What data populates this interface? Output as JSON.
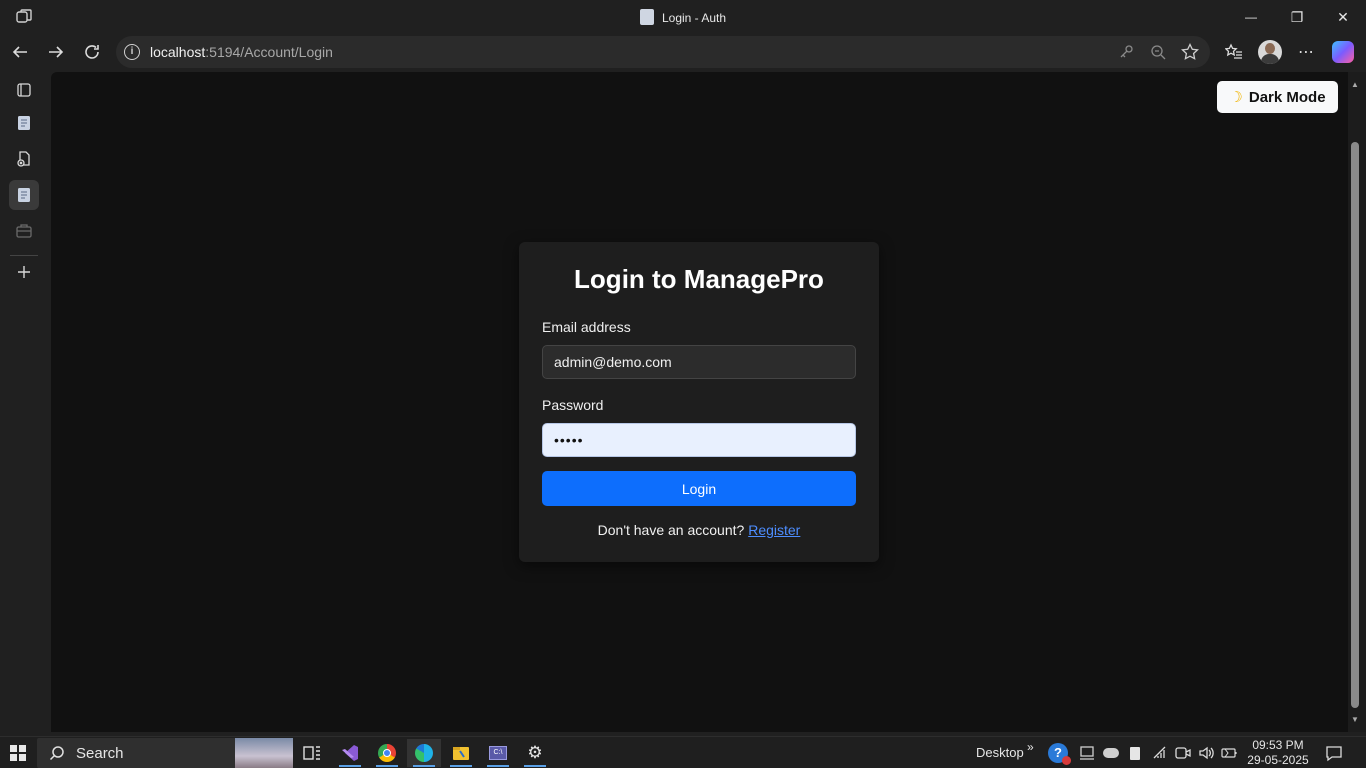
{
  "window": {
    "title": "Login - Auth",
    "minimize_glyph": "—",
    "maximize_glyph": "❐",
    "close_glyph": "✕"
  },
  "addressbar": {
    "url_host": "localhost",
    "url_path": ":5194/Account/Login",
    "info_glyph": "i"
  },
  "page": {
    "darkmode_label": "Dark Mode",
    "heading": "Login to ManagePro",
    "email_label": "Email address",
    "email_value": "admin@demo.com",
    "password_label": "Password",
    "password_value": "•••••",
    "login_label": "Login",
    "register_prompt": "Don't have an account?",
    "register_link": "Register"
  },
  "taskbar": {
    "search_label": "Search",
    "desktop_label": "Desktop",
    "time": "09:53 PM",
    "date": "29-05-2025"
  },
  "colors": {
    "accent": "#0d6efd",
    "link": "#4d8dff",
    "content_bg": "#111111",
    "card_bg": "#1e1e1e"
  }
}
